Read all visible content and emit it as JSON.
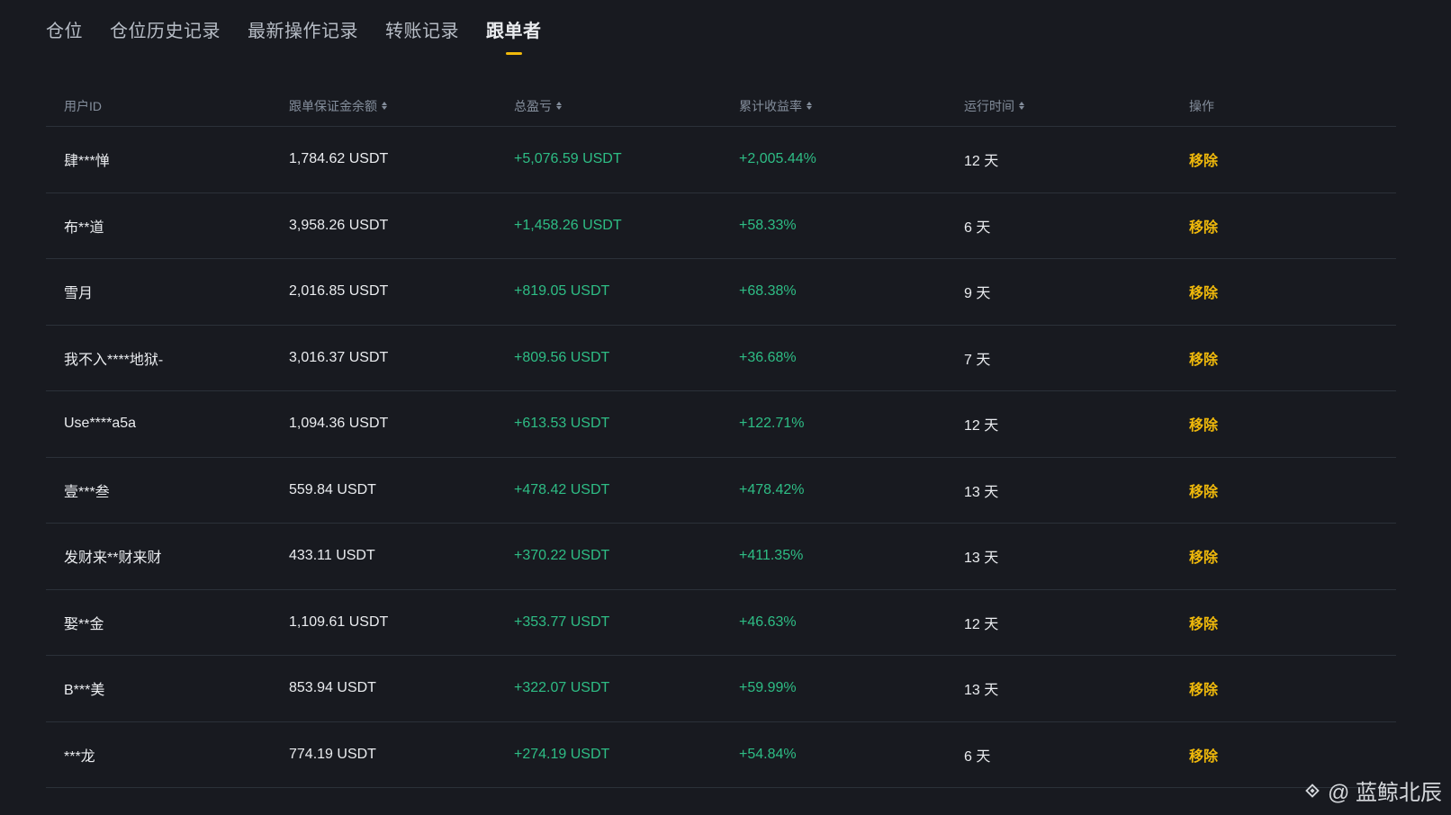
{
  "tabs": [
    {
      "label": "仓位"
    },
    {
      "label": "仓位历史记录"
    },
    {
      "label": "最新操作记录"
    },
    {
      "label": "转账记录"
    },
    {
      "label": "跟单者"
    }
  ],
  "table": {
    "headers": {
      "user_id": "用户ID",
      "margin": "跟单保证金余额",
      "pnl": "总盈亏",
      "roi": "累计收益率",
      "runtime": "运行时间",
      "action": "操作"
    },
    "rows": [
      {
        "user": "肆***惮",
        "margin": "1,784.62 USDT",
        "pnl": "+5,076.59 USDT",
        "roi": "+2,005.44%",
        "runtime": "12 天",
        "action": "移除"
      },
      {
        "user": "布**道",
        "margin": "3,958.26 USDT",
        "pnl": "+1,458.26 USDT",
        "roi": "+58.33%",
        "runtime": "6 天",
        "action": "移除"
      },
      {
        "user": "雪月",
        "margin": "2,016.85 USDT",
        "pnl": "+819.05 USDT",
        "roi": "+68.38%",
        "runtime": "9 天",
        "action": "移除"
      },
      {
        "user": "我不入****地狱-",
        "margin": "3,016.37 USDT",
        "pnl": "+809.56 USDT",
        "roi": "+36.68%",
        "runtime": "7 天",
        "action": "移除"
      },
      {
        "user": "Use****a5a",
        "margin": "1,094.36 USDT",
        "pnl": "+613.53 USDT",
        "roi": "+122.71%",
        "runtime": "12 天",
        "action": "移除"
      },
      {
        "user": "壹***叁",
        "margin": "559.84 USDT",
        "pnl": "+478.42 USDT",
        "roi": "+478.42%",
        "runtime": "13 天",
        "action": "移除"
      },
      {
        "user": "发财来**财来财",
        "margin": "433.11 USDT",
        "pnl": "+370.22 USDT",
        "roi": "+411.35%",
        "runtime": "13 天",
        "action": "移除"
      },
      {
        "user": "娶**金",
        "margin": "1,109.61 USDT",
        "pnl": "+353.77 USDT",
        "roi": "+46.63%",
        "runtime": "12 天",
        "action": "移除"
      },
      {
        "user": "B***美",
        "margin": "853.94 USDT",
        "pnl": "+322.07 USDT",
        "roi": "+59.99%",
        "runtime": "13 天",
        "action": "移除"
      },
      {
        "user": "***龙",
        "margin": "774.19 USDT",
        "pnl": "+274.19 USDT",
        "roi": "+54.84%",
        "runtime": "6 天",
        "action": "移除"
      }
    ]
  },
  "watermark": {
    "icon": "binance-square-icon",
    "text": "@ 蓝鲸北辰"
  },
  "colors": {
    "background": "#181a20",
    "accent": "#f0b90b",
    "positive": "#2ebd85",
    "muted": "#848e9c",
    "divider": "#2b3139"
  }
}
